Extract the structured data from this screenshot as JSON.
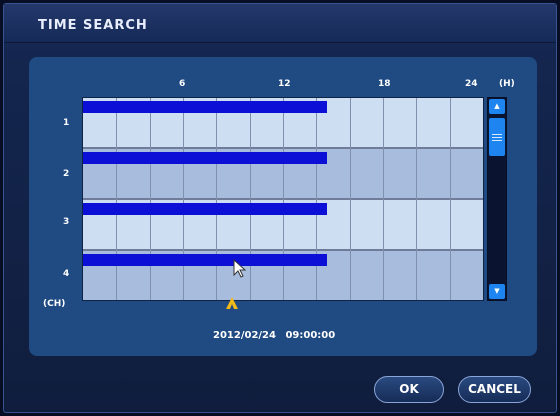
{
  "window": {
    "title": "TIME SEARCH"
  },
  "timeline": {
    "hour_labels": [
      "6",
      "12",
      "18",
      "24"
    ],
    "hour_unit": "(H)",
    "channel_unit": "(CH)",
    "channels": [
      {
        "label": "1",
        "recording_until_hour": 13
      },
      {
        "label": "2",
        "recording_until_hour": 13
      },
      {
        "label": "3",
        "recording_until_hour": 13
      },
      {
        "label": "4",
        "recording_until_hour": 13
      }
    ]
  },
  "scrollbar": {
    "up_icon": "▲",
    "down_icon": "▼"
  },
  "marker_icon": "caret-up-icon",
  "selection": {
    "date": "2012/02/24",
    "time": "09:00:00"
  },
  "buttons": {
    "ok": "OK",
    "cancel": "CANCEL"
  },
  "colors": {
    "recording_bar": "#0c10d6",
    "panel": "#1f4a82",
    "marker": "#f2b818"
  }
}
